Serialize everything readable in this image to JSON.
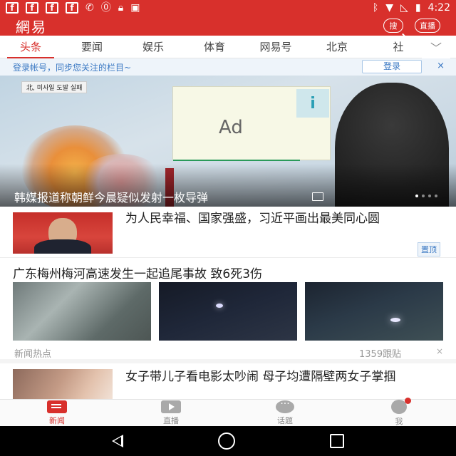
{
  "status_bar": {
    "left_icons": [
      "facebook-icon",
      "facebook-icon",
      "facebook-icon",
      "facebook-icon",
      "missed-call-icon",
      "alert-icon",
      "lock-icon",
      "android-icon"
    ],
    "right_icons": [
      "bluetooth-icon",
      "wifi-icon",
      "no-signal-icon",
      "battery-icon"
    ],
    "time": "4:22"
  },
  "header": {
    "logo": "網易",
    "search_label": "搜",
    "live_label": "直播"
  },
  "tabs": [
    "头条",
    "要闻",
    "娱乐",
    "体育",
    "网易号",
    "北京",
    "社"
  ],
  "active_tab": 0,
  "login_banner": {
    "text": "登录帐号，同步您关注的栏目~",
    "button": "登录",
    "close": "×"
  },
  "hero": {
    "tag": "北, 미사일 도발 실패",
    "ad_label": "Ad",
    "title": "韩媒报道称朝鲜今晨疑似发射一枚导弹",
    "dots": 4,
    "active_dot": 0
  },
  "feed": {
    "item1": {
      "title": "为人民幸福、国家强盛，习近平画出最美同心圆",
      "tag": "置顶"
    },
    "item2": {
      "title": "广东梅州梅河高速发生一起追尾事故 致6死3伤",
      "source": "新闻热点",
      "comments": "1359跟贴",
      "close": "×"
    },
    "item3": {
      "title": "女子带儿子看电影太吵闹 母子均遭隔壁两女子掌掴"
    }
  },
  "bottom_nav": [
    {
      "label": "新闻",
      "icon": "news-icon"
    },
    {
      "label": "直播",
      "icon": "live-icon"
    },
    {
      "label": "话题",
      "icon": "topic-icon"
    },
    {
      "label": "我",
      "icon": "me-icon"
    }
  ],
  "colors": {
    "brand": "#d8302c",
    "link": "#3a78c3",
    "text": "#222222",
    "muted": "#999999"
  }
}
